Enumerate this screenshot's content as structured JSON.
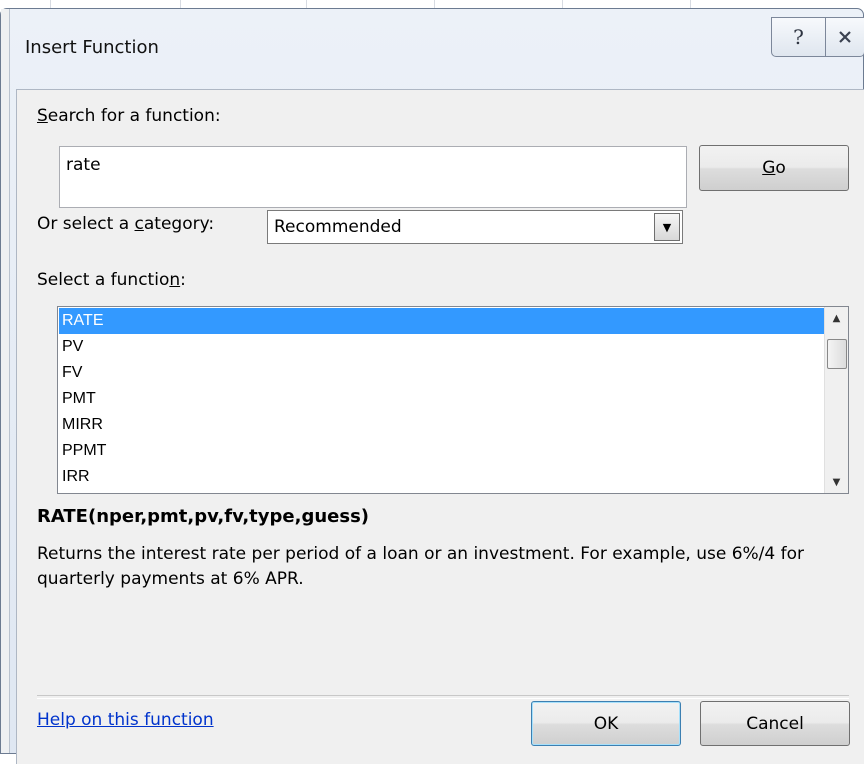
{
  "window": {
    "title": "Insert Function",
    "help_icon": "question-mark-icon",
    "close_icon": "close-icon"
  },
  "search": {
    "label_pre": "",
    "label_key": "S",
    "label_post": "earch for a function:",
    "value": "rate",
    "go_key": "G",
    "go_post": "o"
  },
  "category": {
    "label_pre": "Or select a ",
    "label_key": "c",
    "label_post": "ategory:",
    "selected": "Recommended"
  },
  "function_list": {
    "label_pre": "Select a functio",
    "label_key": "n",
    "label_post": ":",
    "items": [
      "RATE",
      "PV",
      "FV",
      "PMT",
      "MIRR",
      "PPMT",
      "IRR"
    ],
    "selected_index": 0,
    "selection_color": "#3399ff"
  },
  "details": {
    "signature": "RATE(nper,pmt,pv,fv,type,guess)",
    "description": "Returns the interest rate per period of a loan or an investment. For example, use 6%/4 for quarterly payments at 6% APR."
  },
  "footer": {
    "help_link": "Help on this function",
    "ok_label": "OK",
    "cancel_label": "Cancel"
  }
}
